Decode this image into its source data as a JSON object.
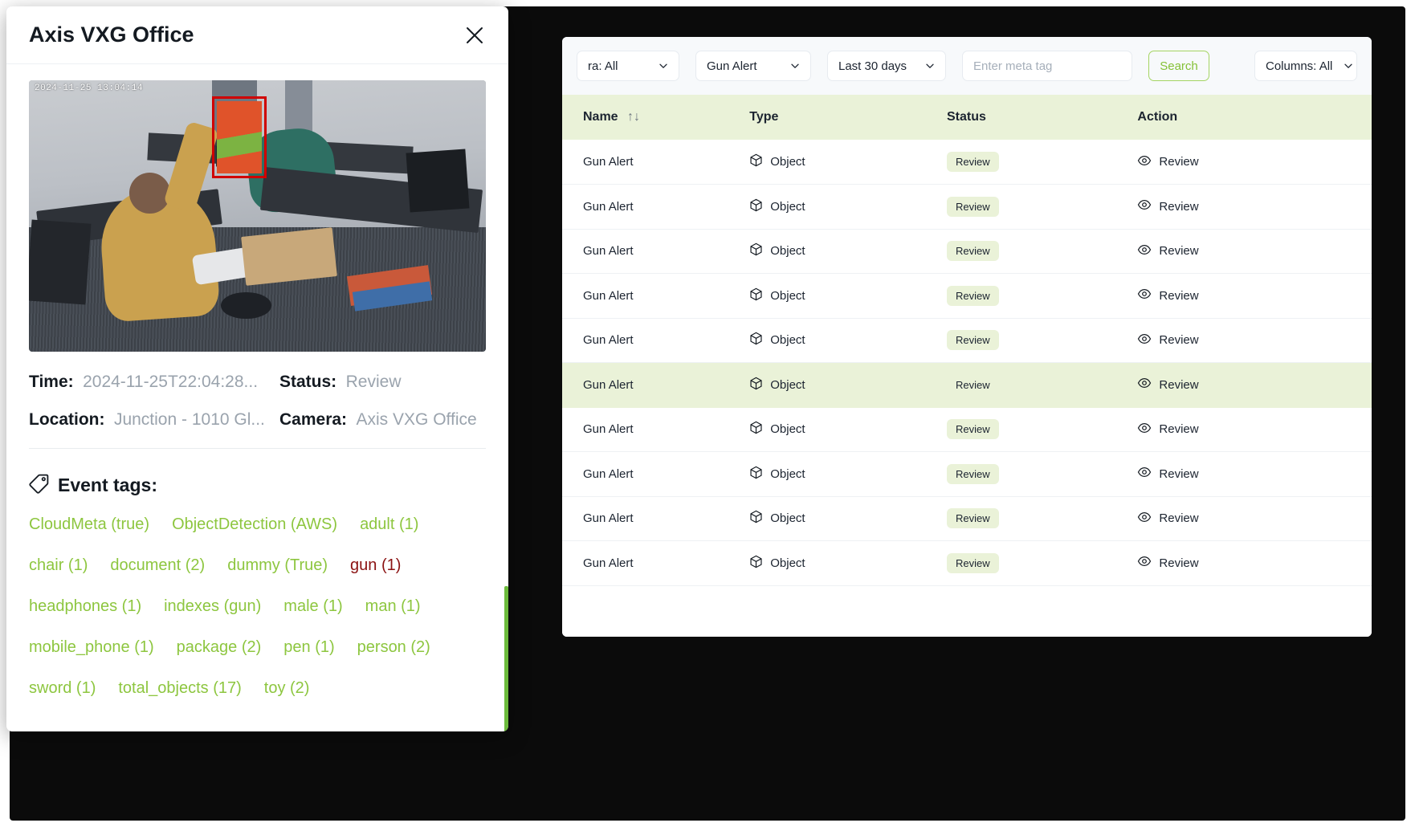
{
  "toolbar": {
    "camera_filter": "ra: All",
    "event_filter": "Gun Alert",
    "date_filter": "Last 30 days",
    "meta_tag_value": "",
    "meta_tag_placeholder": "Enter meta tag",
    "search_label": "Search",
    "columns_filter": "Columns: All"
  },
  "table": {
    "columns": [
      "Name",
      "Type",
      "Status",
      "Action"
    ],
    "sort_glyph": "↑↓",
    "rows": [
      {
        "name": "Gun Alert",
        "type": "Object",
        "status": "Review",
        "action": "Review",
        "highlighted": false
      },
      {
        "name": "Gun Alert",
        "type": "Object",
        "status": "Review",
        "action": "Review",
        "highlighted": false
      },
      {
        "name": "Gun Alert",
        "type": "Object",
        "status": "Review",
        "action": "Review",
        "highlighted": false
      },
      {
        "name": "Gun Alert",
        "type": "Object",
        "status": "Review",
        "action": "Review",
        "highlighted": false
      },
      {
        "name": "Gun Alert",
        "type": "Object",
        "status": "Review",
        "action": "Review",
        "highlighted": false
      },
      {
        "name": "Gun Alert",
        "type": "Object",
        "status": "Review",
        "action": "Review",
        "highlighted": true
      },
      {
        "name": "Gun Alert",
        "type": "Object",
        "status": "Review",
        "action": "Review",
        "highlighted": false
      },
      {
        "name": "Gun Alert",
        "type": "Object",
        "status": "Review",
        "action": "Review",
        "highlighted": false
      },
      {
        "name": "Gun Alert",
        "type": "Object",
        "status": "Review",
        "action": "Review",
        "highlighted": false
      },
      {
        "name": "Gun Alert",
        "type": "Object",
        "status": "Review",
        "action": "Review",
        "highlighted": false
      }
    ]
  },
  "detail": {
    "title": "Axis VXG Office",
    "close_label": "✕",
    "camera_timestamp": "2024-11-25 13:04:14",
    "fields": {
      "time_label": "Time:",
      "time_value": "2024-11-25T22:04:28...",
      "status_label": "Status:",
      "status_value": "Review",
      "location_label": "Location:",
      "location_value": "Junction - 1010 Gl...",
      "camera_label": "Camera:",
      "camera_value": "Axis VXG Office"
    },
    "tags_title": "Event tags:",
    "tags": [
      {
        "label": "CloudMeta (true)",
        "danger": false
      },
      {
        "label": "ObjectDetection (AWS)",
        "danger": false
      },
      {
        "label": "adult (1)",
        "danger": false
      },
      {
        "label": "chair (1)",
        "danger": false
      },
      {
        "label": "document (2)",
        "danger": false
      },
      {
        "label": "dummy (True)",
        "danger": false
      },
      {
        "label": "gun (1)",
        "danger": true
      },
      {
        "label": "headphones (1)",
        "danger": false
      },
      {
        "label": "indexes (gun)",
        "danger": false
      },
      {
        "label": "male (1)",
        "danger": false
      },
      {
        "label": "man (1)",
        "danger": false
      },
      {
        "label": "mobile_phone (1)",
        "danger": false
      },
      {
        "label": "package (2)",
        "danger": false
      },
      {
        "label": "pen (1)",
        "danger": false
      },
      {
        "label": "person (2)",
        "danger": false
      },
      {
        "label": "sword (1)",
        "danger": false
      },
      {
        "label": "total_objects (17)",
        "danger": false
      },
      {
        "label": "toy (2)",
        "danger": false
      }
    ]
  },
  "colors": {
    "accent_green": "#8dc63f",
    "header_row": "#eaf2d8",
    "danger_red": "#8b1212",
    "scrollbar": "#6cbb3c",
    "bbox_red": "#d00000"
  }
}
